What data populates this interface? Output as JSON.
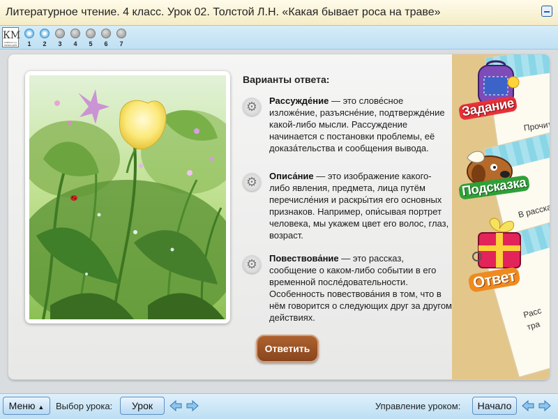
{
  "header": {
    "title": "Литературное чтение. 4 класс. Урок 02. Толстой Л.Н. «Какая бывает роса на траве»"
  },
  "nav": {
    "logo_letters": "КМ",
    "logo_caption": "КИРИЛЛ и МЕФОДИЙ",
    "steps": [
      {
        "num": "1",
        "state": "done"
      },
      {
        "num": "2",
        "state": "done"
      },
      {
        "num": "3",
        "state": "todo"
      },
      {
        "num": "4",
        "state": "todo"
      },
      {
        "num": "5",
        "state": "todo"
      },
      {
        "num": "6",
        "state": "todo"
      },
      {
        "num": "7",
        "state": "todo"
      }
    ]
  },
  "content": {
    "heading": "Варианты ответа:",
    "options": [
      {
        "term": "Рассужде́ние",
        "text": " — это слове́сное изложе́ние, разъясне́ние, подтвержде́ние какой-либо мысли. Рассуждение начинается с постановки проблемы, её доказа́тельства и сообщения вывода."
      },
      {
        "term": "Описа́ние",
        "text": " — это изображение какого-либо явления, предмета, лица путём перечисле́ния и раскры́тия его основных признаков. Например, опи́сывая портрет человека, мы укажем цвет его волос, глаз, возраст."
      },
      {
        "term": "Повествова́ние",
        "text": " — это рассказ, сообщение о каком-либо событии в его временной после́довательности. Особенность повествова́ния в том, что в нём говорится о следующих друг за другом действиях."
      }
    ],
    "answer_button": "Ответить"
  },
  "side": {
    "tabs": [
      {
        "label": "Задание",
        "sheet_text": "Прочит"
      },
      {
        "label": "Подсказка",
        "sheet_text": "В рассказе"
      },
      {
        "label": "Ответ",
        "sheet_text": "Расс",
        "sheet_text2": "тра"
      }
    ]
  },
  "toolbar": {
    "menu": "Меню",
    "lesson_select_label": "Выбор урока:",
    "lesson_button": "Урок",
    "control_label": "Управление уроком:",
    "start_button": "Начало"
  },
  "colors": {
    "accent": "#1a5da8",
    "tab_zadanie": "#e8323a",
    "tab_podskazka": "#2fa037",
    "tab_otvet": "#ef8a1e"
  }
}
